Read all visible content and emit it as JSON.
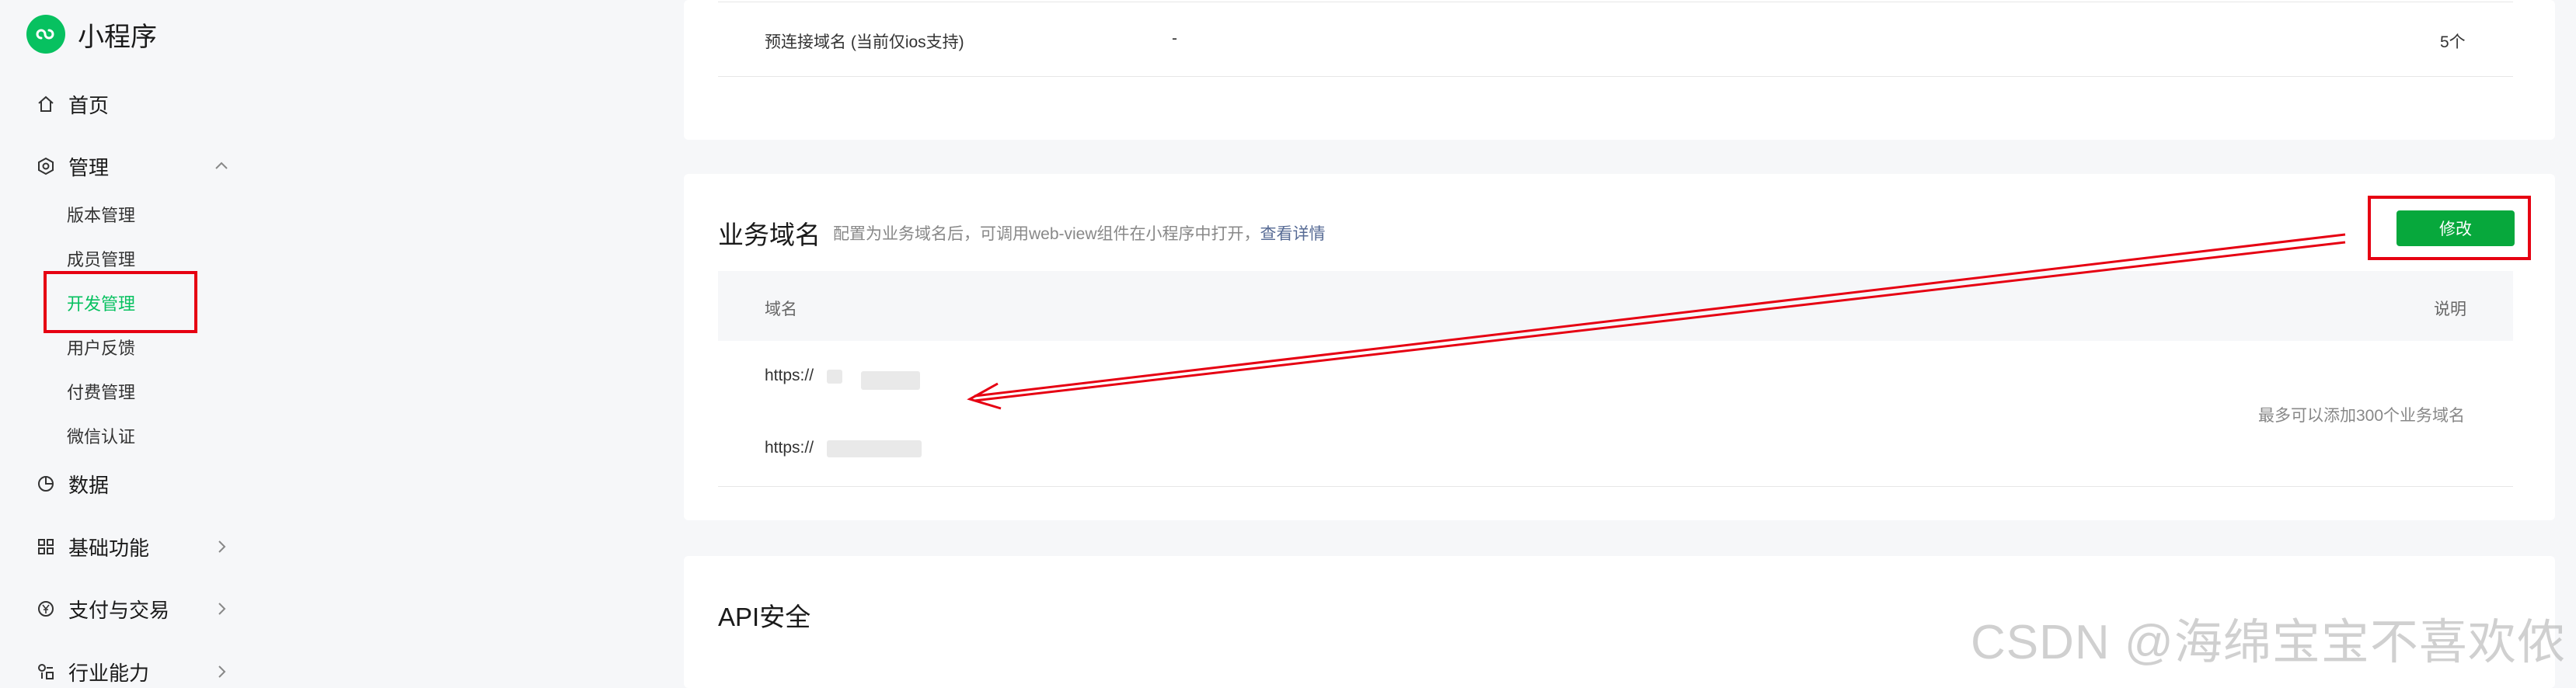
{
  "brand": {
    "name": "小程序"
  },
  "sidebar": {
    "home": "首页",
    "manage": {
      "label": "管理",
      "children": [
        "版本管理",
        "成员管理",
        "开发管理",
        "用户反馈",
        "付费管理",
        "微信认证"
      ],
      "active": "开发管理"
    },
    "data": "数据",
    "basic": "基础功能",
    "pay": "支付与交易",
    "industry": "行业能力"
  },
  "preconnect": {
    "label": "预连接域名 (当前仅ios支持)",
    "value": "-",
    "count": "5个"
  },
  "business_domain": {
    "title": "业务域名",
    "description": "配置为业务域名后，可调用web-view组件在小程序中打开，",
    "link": "查看详情",
    "modify_button": "修改",
    "table": {
      "col_domain": "域名",
      "col_note": "说明",
      "rows": [
        "https://",
        "https://"
      ],
      "note": "最多可以添加300个业务域名"
    }
  },
  "api_security": {
    "title": "API安全"
  },
  "watermark": "CSDN @海绵宝宝不喜欢侬",
  "colors": {
    "accent": "#07c160",
    "button": "#07a83c",
    "annotation": "#e60012",
    "link": "#576b95"
  }
}
